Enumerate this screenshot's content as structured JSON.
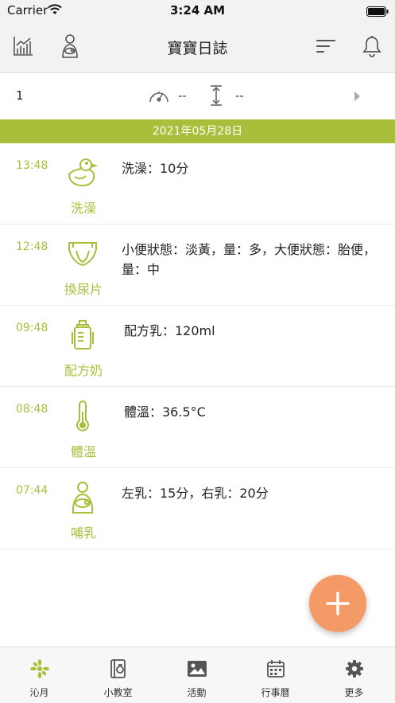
{
  "status_bar": {
    "carrier": "Carrier",
    "time": "3:24 AM"
  },
  "header": {
    "title": "寶寶日誌"
  },
  "summary": {
    "count": "1",
    "speed_value": "--",
    "height_value": "--"
  },
  "date_bar": {
    "date": "2021年05月28日"
  },
  "entries": [
    {
      "time": "13:48",
      "icon": "duck-icon",
      "label": "洗澡",
      "detail": "洗澡：10分"
    },
    {
      "time": "12:48",
      "icon": "diaper-icon",
      "label": "換尿片",
      "detail": "小便狀態：淡黃，量：多，大便狀態：胎便，量：中"
    },
    {
      "time": "09:48",
      "icon": "bottle-icon",
      "label": "配方奶",
      "detail": "配方乳：120ml"
    },
    {
      "time": "08:48",
      "icon": "thermometer-icon",
      "label": "體溫",
      "detail": "體溫：36.5°C"
    },
    {
      "time": "07:44",
      "icon": "breastfeeding-icon",
      "label": "哺乳",
      "detail": "左乳：15分，右乳：20分"
    }
  ],
  "tabs": [
    {
      "label": "沁月",
      "icon": "sprout-icon",
      "active": true
    },
    {
      "label": "小教室",
      "icon": "book-icon",
      "active": false
    },
    {
      "label": "活動",
      "icon": "image-icon",
      "active": false
    },
    {
      "label": "行事曆",
      "icon": "calendar-icon",
      "active": false
    },
    {
      "label": "更多",
      "icon": "gear-icon",
      "active": false
    }
  ],
  "colors": {
    "accent": "#a9bf3b",
    "fab": "#f49a66",
    "icon_gray": "#555555"
  }
}
